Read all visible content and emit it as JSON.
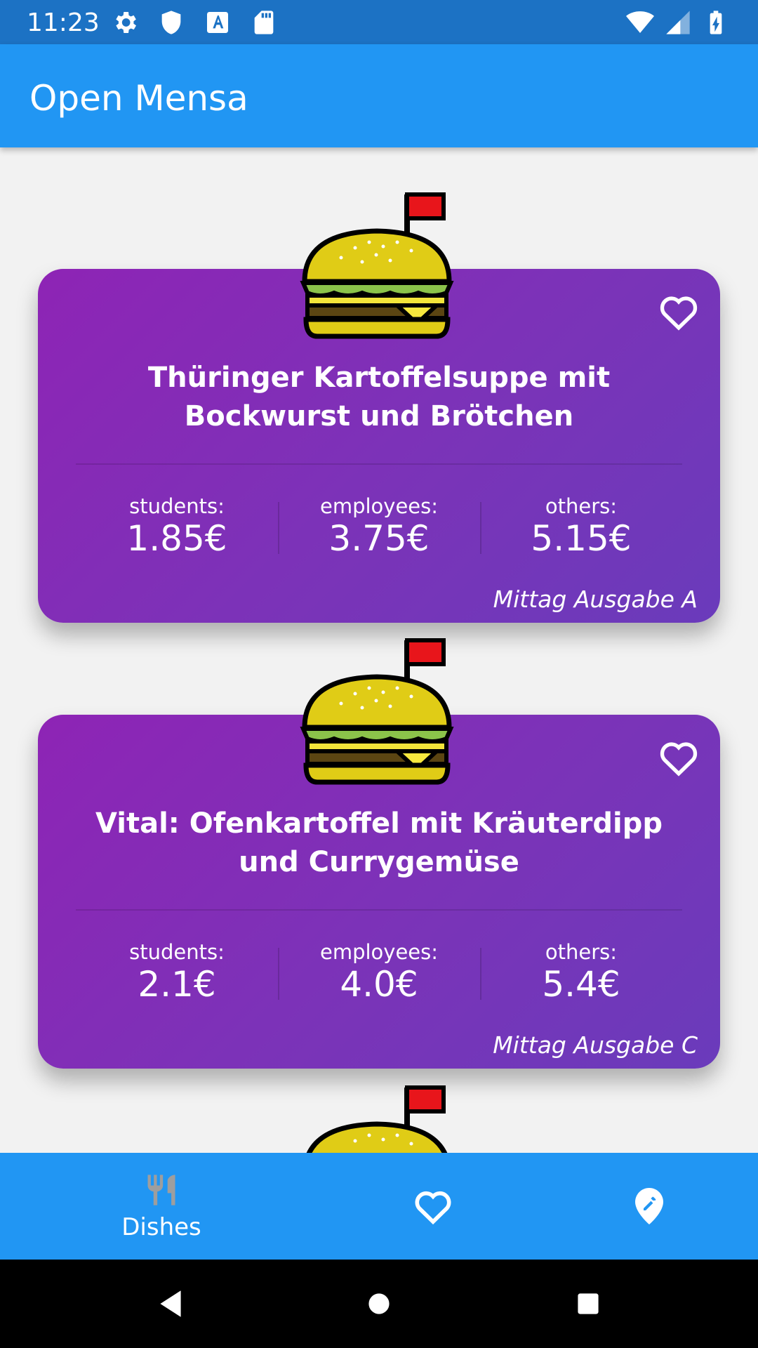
{
  "status_bar": {
    "time": "11:23",
    "icons_left": [
      "settings-icon",
      "shield-icon",
      "text-a-icon",
      "sd-card-icon"
    ],
    "icons_right": [
      "wifi-icon",
      "signal-icon",
      "battery-charging-icon"
    ]
  },
  "app_bar": {
    "title": "Open Mensa"
  },
  "dishes": [
    {
      "name": "Thüringer Kartoffelsuppe mit Bockwurst und Brötchen",
      "prices": [
        {
          "label": "students:",
          "value": "1.85€"
        },
        {
          "label": "employees:",
          "value": "3.75€"
        },
        {
          "label": "others:",
          "value": "5.15€"
        }
      ],
      "location": "Mittag Ausgabe A",
      "favorite": false
    },
    {
      "name": "Vital: Ofenkartoffel mit Kräuterdipp und Currygemüse",
      "prices": [
        {
          "label": "students:",
          "value": "2.1€"
        },
        {
          "label": "employees:",
          "value": "4.0€"
        },
        {
          "label": "others:",
          "value": "5.4€"
        }
      ],
      "location": "Mittag Ausgabe C",
      "favorite": false
    }
  ],
  "bottom_nav": {
    "items": [
      {
        "label": "Dishes",
        "icon": "cutlery-icon",
        "active": true
      },
      {
        "label": "",
        "icon": "heart-icon",
        "active": false
      },
      {
        "label": "",
        "icon": "location-edit-icon",
        "active": false
      }
    ]
  },
  "colors": {
    "status_bar": "#1c72c4",
    "app_bar": "#2196f3",
    "card_gradient_start": "#8e24b5",
    "card_gradient_end": "#6a3bbb",
    "background": "#f2f2f2"
  }
}
